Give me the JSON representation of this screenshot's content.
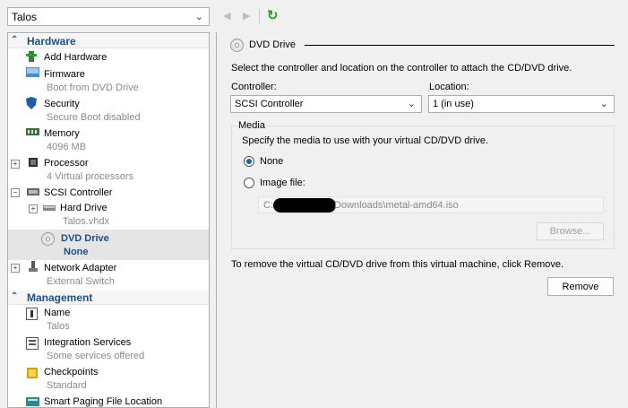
{
  "vm_selector": {
    "value": "Talos"
  },
  "left": {
    "hardware_header": "Hardware",
    "management_header": "Management",
    "hardware_items": [
      {
        "name": "Add Hardware",
        "sub": ""
      },
      {
        "name": "Firmware",
        "sub": "Boot from DVD Drive"
      },
      {
        "name": "Security",
        "sub": "Secure Boot disabled"
      },
      {
        "name": "Memory",
        "sub": "4096 MB"
      },
      {
        "name": "Processor",
        "sub": "4 Virtual processors"
      },
      {
        "name": "SCSI Controller",
        "sub": ""
      },
      {
        "name": "Hard Drive",
        "sub": "Talos.vhdx"
      },
      {
        "name": "DVD Drive",
        "sub": "None"
      },
      {
        "name": "Network Adapter",
        "sub": "External Switch"
      }
    ],
    "management_items": [
      {
        "name": "Name",
        "sub": "Talos"
      },
      {
        "name": "Integration Services",
        "sub": "Some services offered"
      },
      {
        "name": "Checkpoints",
        "sub": "Standard"
      },
      {
        "name": "Smart Paging File Location",
        "sub": ""
      }
    ]
  },
  "right": {
    "section_title": "DVD Drive",
    "description": "Select the controller and location on the controller to attach the CD/DVD drive.",
    "controller_label": "Controller:",
    "controller_value": "SCSI Controller",
    "location_label": "Location:",
    "location_value": "1 (in use)",
    "media_group_label": "Media",
    "media_instruction": "Specify the media to use with your virtual CD/DVD drive.",
    "radio_none_label": "None",
    "radio_image_label": "Image file:",
    "selected_media": "none",
    "image_path_prefix": "C:",
    "image_path_suffix": "Downloads\\metal-amd64.iso",
    "browse_label": "Browse...",
    "remove_note": "To remove the virtual CD/DVD drive from this virtual machine, click Remove.",
    "remove_label": "Remove"
  },
  "colors": {
    "accent": "#1f5fa8",
    "header_text": "#1f4e8c",
    "subtext": "#8a8a8a",
    "selected_bg": "#e5e5e5",
    "refresh_green": "#2e9e2e"
  }
}
